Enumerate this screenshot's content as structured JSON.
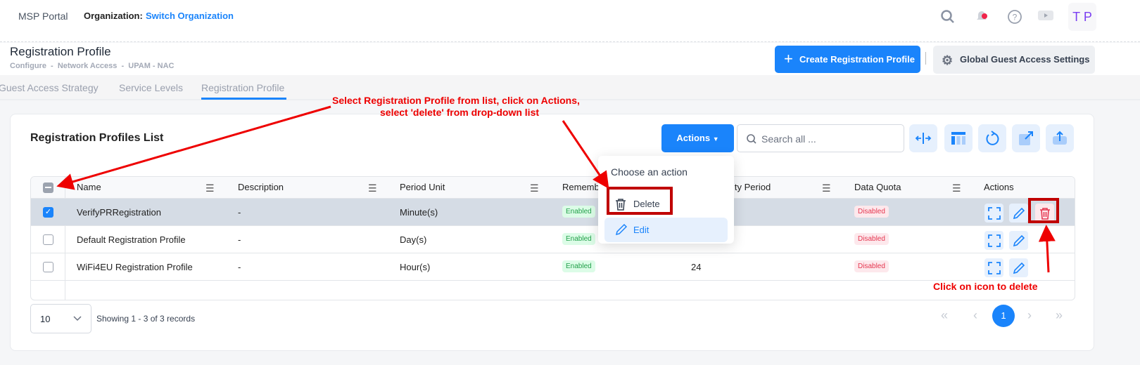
{
  "topbar": {
    "app": "MSP Portal",
    "org_label": "Organization:",
    "org_link": "Switch Organization",
    "avatar": "T P"
  },
  "header": {
    "title": "Registration Profile",
    "breadcrumb": "Configure  -  Network Access  -  UPAM - NAC",
    "create_button": "Create Registration Profile",
    "settings_button": "Global Guest Access Settings"
  },
  "tabs": [
    {
      "label": "Guest Access Strategy"
    },
    {
      "label": "Service Levels"
    },
    {
      "label": "Registration Profile",
      "active": true
    }
  ],
  "card": {
    "title": "Registration Profiles List",
    "actions_button": "Actions",
    "search_placeholder": "Search all ..."
  },
  "dropdown": {
    "title": "Choose an action",
    "items": [
      {
        "label": "Delete",
        "icon": "trash-icon"
      },
      {
        "label": "Edit",
        "icon": "pencil-icon"
      }
    ]
  },
  "table": {
    "columns": [
      "Name",
      "Description",
      "Period Unit",
      "Rememb",
      "lidity Period",
      "Data Quota",
      "Actions"
    ],
    "rows": [
      {
        "name": "VerifyPRRegistration",
        "description": "-",
        "period_unit": "Minute(s)",
        "remember": "Enabled",
        "validity": "",
        "data_quota": "Disabled",
        "checked": true
      },
      {
        "name": "Default Registration Profile",
        "description": "-",
        "period_unit": "Day(s)",
        "remember": "Enabled",
        "validity": "",
        "data_quota": "Disabled",
        "checked": false
      },
      {
        "name": "WiFi4EU Registration Profile",
        "description": "-",
        "period_unit": "Hour(s)",
        "remember": "Enabled",
        "validity": "24",
        "data_quota": "Disabled",
        "checked": false
      }
    ]
  },
  "footer": {
    "page_size": "10",
    "showing": "Showing 1 - 3 of 3 records",
    "current_page": "1"
  },
  "annotations": {
    "top_line1": "Select Registration Profile from list, click on Actions,",
    "top_line2": "select 'delete' from drop-down list",
    "bottom": "Click on icon to delete"
  },
  "colors": {
    "primary": "#1a84fb",
    "annotation": "#e00000"
  }
}
